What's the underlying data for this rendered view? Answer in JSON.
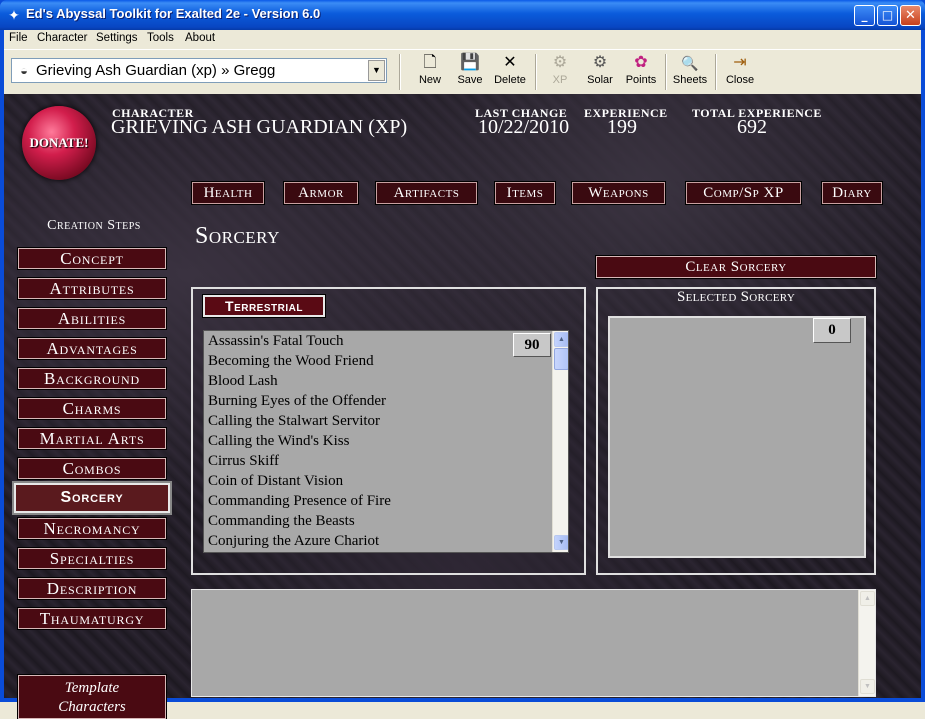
{
  "window": {
    "title": "Ed's Abyssal Toolkit for Exalted 2e - Version 6.0",
    "icon": "app-icon",
    "controls": {
      "minimize": "_",
      "maximize": "□",
      "close": "✕"
    }
  },
  "menu": [
    "File",
    "Character",
    "Settings",
    "Tools",
    "About"
  ],
  "toolbar": {
    "character_select": "Grieving Ash Guardian (xp) » Gregg",
    "buttons": [
      {
        "label": "New",
        "icon": "new-file-icon",
        "glyph": "🗋",
        "enabled": true
      },
      {
        "label": "Save",
        "icon": "save-disk-icon",
        "glyph": "💾",
        "enabled": true
      },
      {
        "label": "Delete",
        "icon": "delete-x-icon",
        "glyph": "✕",
        "enabled": true
      },
      {
        "label": "XP",
        "icon": "xp-icon",
        "glyph": "⚙",
        "enabled": false
      },
      {
        "label": "Solar",
        "icon": "solar-icon",
        "glyph": "⚙",
        "enabled": true
      },
      {
        "label": "Points",
        "icon": "points-icon",
        "glyph": "✿",
        "enabled": true
      },
      {
        "label": "Sheets",
        "icon": "sheets-icon",
        "glyph": "🔍",
        "enabled": true
      },
      {
        "label": "Close",
        "icon": "close-door-icon",
        "glyph": "⇥",
        "enabled": true
      }
    ]
  },
  "header": {
    "character_label": "CHARACTER",
    "character_name": "GRIEVING ASH GUARDIAN (XP)",
    "last_change_label": "LAST CHANGE",
    "last_change": "10/22/2010",
    "experience_label": "EXPERIENCE",
    "experience": "199",
    "total_experience_label": "TOTAL EXPERIENCE",
    "total_experience": "692",
    "donate": "DONATE!"
  },
  "tabs": [
    "Health",
    "Armor",
    "Artifacts",
    "Items",
    "Weapons",
    "Comp/Sp XP",
    "Diary"
  ],
  "creation_steps": {
    "title": "Creation Steps",
    "items": [
      "Concept",
      "Attributes",
      "Abilities",
      "Advantages",
      "Background",
      "Charms",
      "Martial Arts",
      "Combos",
      "Sorcery",
      "Necromancy",
      "Specialties",
      "Description",
      "Thaumaturgy"
    ],
    "active": "Sorcery",
    "template_button": [
      "Template",
      "Characters"
    ]
  },
  "sorcery": {
    "title": "Sorcery",
    "clear_button": "Clear Sorcery",
    "circle_label": "Terrestrial",
    "spells": [
      "Assassin's Fatal Touch",
      "Becoming the Wood Friend",
      "Blood Lash",
      "Burning Eyes of the Offender",
      "Calling the Stalwart Servitor",
      "Calling the Wind's Kiss",
      "Cirrus Skiff",
      "Coin of Distant Vision",
      "Commanding Presence of Fire",
      "Commanding the Beasts",
      "Conjuring the Azure Chariot"
    ],
    "spell_cost": "90",
    "selected_title": "Selected Sorcery",
    "selected_cost": "0",
    "selected_spells": []
  }
}
